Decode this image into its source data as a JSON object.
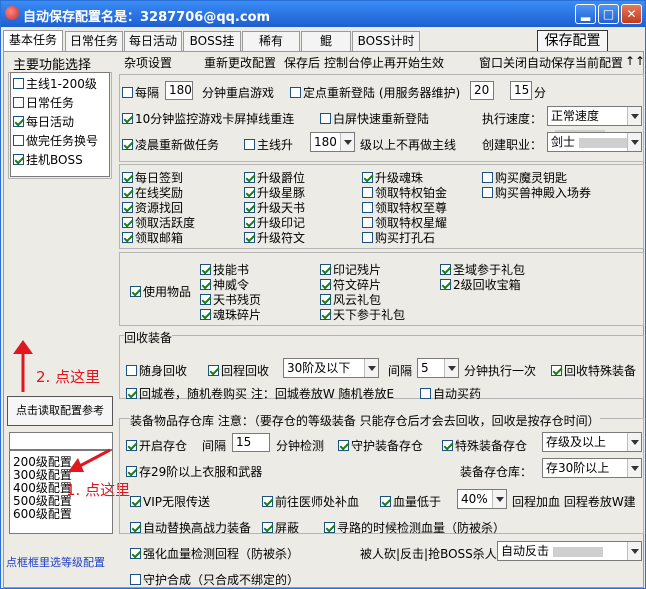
{
  "window": {
    "title": "自动保存配置名是：3287706@qq.com",
    "min": "▂",
    "max": "□",
    "close": "✕"
  },
  "tabs": [
    "基本任务",
    "日常任务",
    "每日活动",
    "BOSS挂机",
    "稀有BOSS",
    "鲲",
    "BOSS计时器"
  ],
  "save_button": "保存配置",
  "left": {
    "title": "主要功能选择",
    "funcs": [
      {
        "label": "主线1-200级",
        "on": false
      },
      {
        "label": "日常任务",
        "on": false
      },
      {
        "label": "每日活动",
        "on": true
      },
      {
        "label": "做完任务换号",
        "on": false
      },
      {
        "label": "挂机BOSS",
        "on": true
      }
    ],
    "read_button": "点击读取配置参考",
    "configs": [
      "200级配置",
      "300级配置",
      "400级配置",
      "500级配置",
      "600级配置"
    ],
    "hint": "点框框里选等级配置",
    "annot1": "1. 点这里",
    "annot2": "2. 点这里"
  },
  "misc": {
    "header": [
      "杂项设置",
      "重新更改配置",
      "保存后",
      "控制台停止再开始生效",
      "窗口关闭自动保存当前配置"
    ],
    "arrows": "↑↑",
    "every": "每隔",
    "every_val": "180",
    "every_suffix": "分钟重启游戏",
    "timed": "定点重新登陆 (用服务器维护)",
    "h": "20",
    "m": "15",
    "unit": "分",
    "monitor": "10分钟监控游戏卡屏掉线重连",
    "white": "白屏快速重新登陆",
    "speed_label": "执行速度：",
    "speed": "正常速度",
    "dawn": "凌晨重新做任务",
    "mainline": "主线升",
    "main_lvl": "180",
    "main_suffix": "级以上不再做主线",
    "job_label": "创建职业：",
    "job": "剑士"
  },
  "tasks": [
    [
      {
        "l": "每日签到",
        "on": true
      },
      {
        "l": "升级爵位",
        "on": true
      },
      {
        "l": "升级魂珠",
        "on": true
      },
      {
        "l": "购买魔灵钥匙",
        "on": false
      }
    ],
    [
      {
        "l": "在线奖励",
        "on": true
      },
      {
        "l": "升级星豚",
        "on": true
      },
      {
        "l": "领取特权铂金",
        "on": false
      },
      {
        "l": "购买兽神殿入场券",
        "on": false
      }
    ],
    [
      {
        "l": "资源找回",
        "on": true
      },
      {
        "l": "升级天书",
        "on": true
      },
      {
        "l": "领取特权至尊",
        "on": false
      },
      {
        "l": "",
        "on": false
      }
    ],
    [
      {
        "l": "领取活跃度",
        "on": true
      },
      {
        "l": "升级印记",
        "on": true
      },
      {
        "l": "领取特权星耀",
        "on": false
      },
      {
        "l": "",
        "on": false
      }
    ],
    [
      {
        "l": "领取邮箱",
        "on": true
      },
      {
        "l": "升级符文",
        "on": true
      },
      {
        "l": "购买打孔石",
        "on": false
      },
      {
        "l": "",
        "on": false
      }
    ]
  ],
  "items": {
    "use": "使用物品",
    "list": [
      [
        {
          "l": "技能书",
          "on": true
        },
        {
          "l": "印记残片",
          "on": true
        },
        {
          "l": "圣域参于礼包",
          "on": true
        }
      ],
      [
        {
          "l": "神威令",
          "on": true
        },
        {
          "l": "符文碎片",
          "on": true
        },
        {
          "l": "2级回收宝箱",
          "on": true
        }
      ],
      [
        {
          "l": "天书残页",
          "on": true
        },
        {
          "l": "风云礼包",
          "on": true
        },
        {
          "l": "",
          "on": false
        }
      ],
      [
        {
          "l": "魂珠碎片",
          "on": true
        },
        {
          "l": "天下参于礼包",
          "on": true
        },
        {
          "l": "",
          "on": false
        }
      ]
    ]
  },
  "recycle": {
    "title": "回收装备",
    "random": "随身回收",
    "home": "回程回收",
    "level": "30阶及以下",
    "gap": "间隔",
    "gap_val": "5",
    "gap_suffix": "分钟执行一次",
    "special": "回收特殊装备",
    "scroll": "回城卷，随机卷购买 注：回城卷放W 随机卷放E",
    "drug": "自动买药"
  },
  "storage": {
    "title": "装备物品存仓库 注意：（要存仓的等级装备 只能存仓后才会去回收，回收是按存仓时间）",
    "open": "开启存仓",
    "gap": "间隔",
    "gap_val": "15",
    "gap_suffix": "分钟检测",
    "guard": "守护装备存仓",
    "special": "特殊装备存仓",
    "lvl": "存级及以上",
    "store29": "存29阶以上衣服和武器",
    "wh_label": "装备存仓库：",
    "wh": "存30阶以上"
  },
  "bottom": {
    "vip": "VIP无限传送",
    "doctor": "前往医师处补血",
    "hp_low": "血量低于",
    "hp_val": "40%",
    "hp_suffix": "回程加血 回程卷放W建",
    "replace": "自动替换高战力装备",
    "shield": "屏蔽",
    "detect": "寻路的时候检测血量（防被杀）",
    "force": "强化血量检测回程（防被杀）",
    "killed": "被人砍|反击|抢BOSS杀人",
    "react": "自动反击",
    "guardsyn": "守护合成（只合成不绑定的）"
  }
}
